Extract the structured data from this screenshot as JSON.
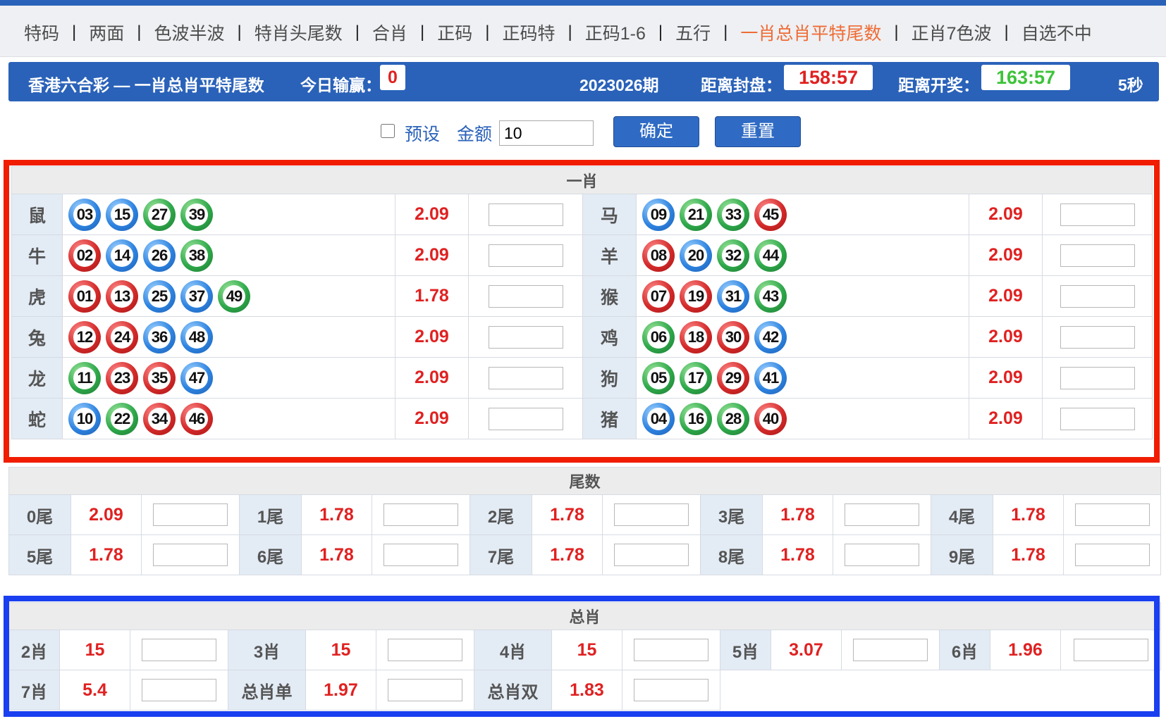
{
  "nav": {
    "tabs": [
      "特码",
      "两面",
      "色波半波",
      "特肖头尾数",
      "合肖",
      "正码",
      "正码特",
      "正码1-6",
      "五行",
      "一肖总肖平特尾数",
      "正肖7色波",
      "自选不中"
    ],
    "active_index": 9,
    "separator": "|"
  },
  "header": {
    "title": "香港六合彩 — 一肖总肖平特尾数",
    "today_label": "今日输赢：",
    "today_value": "0",
    "period": "2023026期",
    "close_label": "距离封盘：",
    "close_time": "158:57",
    "draw_label": "距离开奖：",
    "draw_time": "163:57",
    "refresh": "5秒"
  },
  "controls": {
    "preset_label": "预设",
    "amount_label": "金额",
    "amount_value": "10",
    "confirm_label": "确定",
    "reset_label": "重置"
  },
  "yixiao": {
    "title": "一肖",
    "rows": [
      {
        "left": {
          "name": "鼠",
          "balls": [
            {
              "n": "03",
              "c": "blue"
            },
            {
              "n": "15",
              "c": "blue"
            },
            {
              "n": "27",
              "c": "green"
            },
            {
              "n": "39",
              "c": "green"
            }
          ],
          "odds": "2.09"
        },
        "right": {
          "name": "马",
          "balls": [
            {
              "n": "09",
              "c": "blue"
            },
            {
              "n": "21",
              "c": "green"
            },
            {
              "n": "33",
              "c": "green"
            },
            {
              "n": "45",
              "c": "red"
            }
          ],
          "odds": "2.09"
        }
      },
      {
        "left": {
          "name": "牛",
          "balls": [
            {
              "n": "02",
              "c": "red"
            },
            {
              "n": "14",
              "c": "blue"
            },
            {
              "n": "26",
              "c": "blue"
            },
            {
              "n": "38",
              "c": "green"
            }
          ],
          "odds": "2.09"
        },
        "right": {
          "name": "羊",
          "balls": [
            {
              "n": "08",
              "c": "red"
            },
            {
              "n": "20",
              "c": "blue"
            },
            {
              "n": "32",
              "c": "green"
            },
            {
              "n": "44",
              "c": "green"
            }
          ],
          "odds": "2.09"
        }
      },
      {
        "left": {
          "name": "虎",
          "balls": [
            {
              "n": "01",
              "c": "red"
            },
            {
              "n": "13",
              "c": "red"
            },
            {
              "n": "25",
              "c": "blue"
            },
            {
              "n": "37",
              "c": "blue"
            },
            {
              "n": "49",
              "c": "green"
            }
          ],
          "odds": "1.78"
        },
        "right": {
          "name": "猴",
          "balls": [
            {
              "n": "07",
              "c": "red"
            },
            {
              "n": "19",
              "c": "red"
            },
            {
              "n": "31",
              "c": "blue"
            },
            {
              "n": "43",
              "c": "green"
            }
          ],
          "odds": "2.09"
        }
      },
      {
        "left": {
          "name": "兔",
          "balls": [
            {
              "n": "12",
              "c": "red"
            },
            {
              "n": "24",
              "c": "red"
            },
            {
              "n": "36",
              "c": "blue"
            },
            {
              "n": "48",
              "c": "blue"
            }
          ],
          "odds": "2.09"
        },
        "right": {
          "name": "鸡",
          "balls": [
            {
              "n": "06",
              "c": "green"
            },
            {
              "n": "18",
              "c": "red"
            },
            {
              "n": "30",
              "c": "red"
            },
            {
              "n": "42",
              "c": "blue"
            }
          ],
          "odds": "2.09"
        }
      },
      {
        "left": {
          "name": "龙",
          "balls": [
            {
              "n": "11",
              "c": "green"
            },
            {
              "n": "23",
              "c": "red"
            },
            {
              "n": "35",
              "c": "red"
            },
            {
              "n": "47",
              "c": "blue"
            }
          ],
          "odds": "2.09"
        },
        "right": {
          "name": "狗",
          "balls": [
            {
              "n": "05",
              "c": "green"
            },
            {
              "n": "17",
              "c": "green"
            },
            {
              "n": "29",
              "c": "red"
            },
            {
              "n": "41",
              "c": "blue"
            }
          ],
          "odds": "2.09"
        }
      },
      {
        "left": {
          "name": "蛇",
          "balls": [
            {
              "n": "10",
              "c": "blue"
            },
            {
              "n": "22",
              "c": "green"
            },
            {
              "n": "34",
              "c": "red"
            },
            {
              "n": "46",
              "c": "red"
            }
          ],
          "odds": "2.09"
        },
        "right": {
          "name": "猪",
          "balls": [
            {
              "n": "04",
              "c": "blue"
            },
            {
              "n": "16",
              "c": "green"
            },
            {
              "n": "28",
              "c": "green"
            },
            {
              "n": "40",
              "c": "red"
            }
          ],
          "odds": "2.09"
        }
      }
    ]
  },
  "weishu": {
    "title": "尾数",
    "items": [
      {
        "label": "0尾",
        "odds": "2.09"
      },
      {
        "label": "1尾",
        "odds": "1.78"
      },
      {
        "label": "2尾",
        "odds": "1.78"
      },
      {
        "label": "3尾",
        "odds": "1.78"
      },
      {
        "label": "4尾",
        "odds": "1.78"
      },
      {
        "label": "5尾",
        "odds": "1.78"
      },
      {
        "label": "6尾",
        "odds": "1.78"
      },
      {
        "label": "7尾",
        "odds": "1.78"
      },
      {
        "label": "8尾",
        "odds": "1.78"
      },
      {
        "label": "9尾",
        "odds": "1.78"
      }
    ]
  },
  "zongxiao": {
    "title": "总肖",
    "items": [
      {
        "label": "2肖",
        "odds": "15"
      },
      {
        "label": "3肖",
        "odds": "15"
      },
      {
        "label": "4肖",
        "odds": "15"
      },
      {
        "label": "5肖",
        "odds": "3.07"
      },
      {
        "label": "6肖",
        "odds": "1.96"
      },
      {
        "label": "7肖",
        "odds": "5.4"
      },
      {
        "label": "总肖单",
        "odds": "1.97"
      },
      {
        "label": "总肖双",
        "odds": "1.83"
      }
    ]
  },
  "colors": {
    "primary": "#2a62b9",
    "accent": "#ef6b34",
    "odds": "#e02121",
    "highlight_red": "#f01d00",
    "highlight_blue": "#1a3ff0"
  }
}
